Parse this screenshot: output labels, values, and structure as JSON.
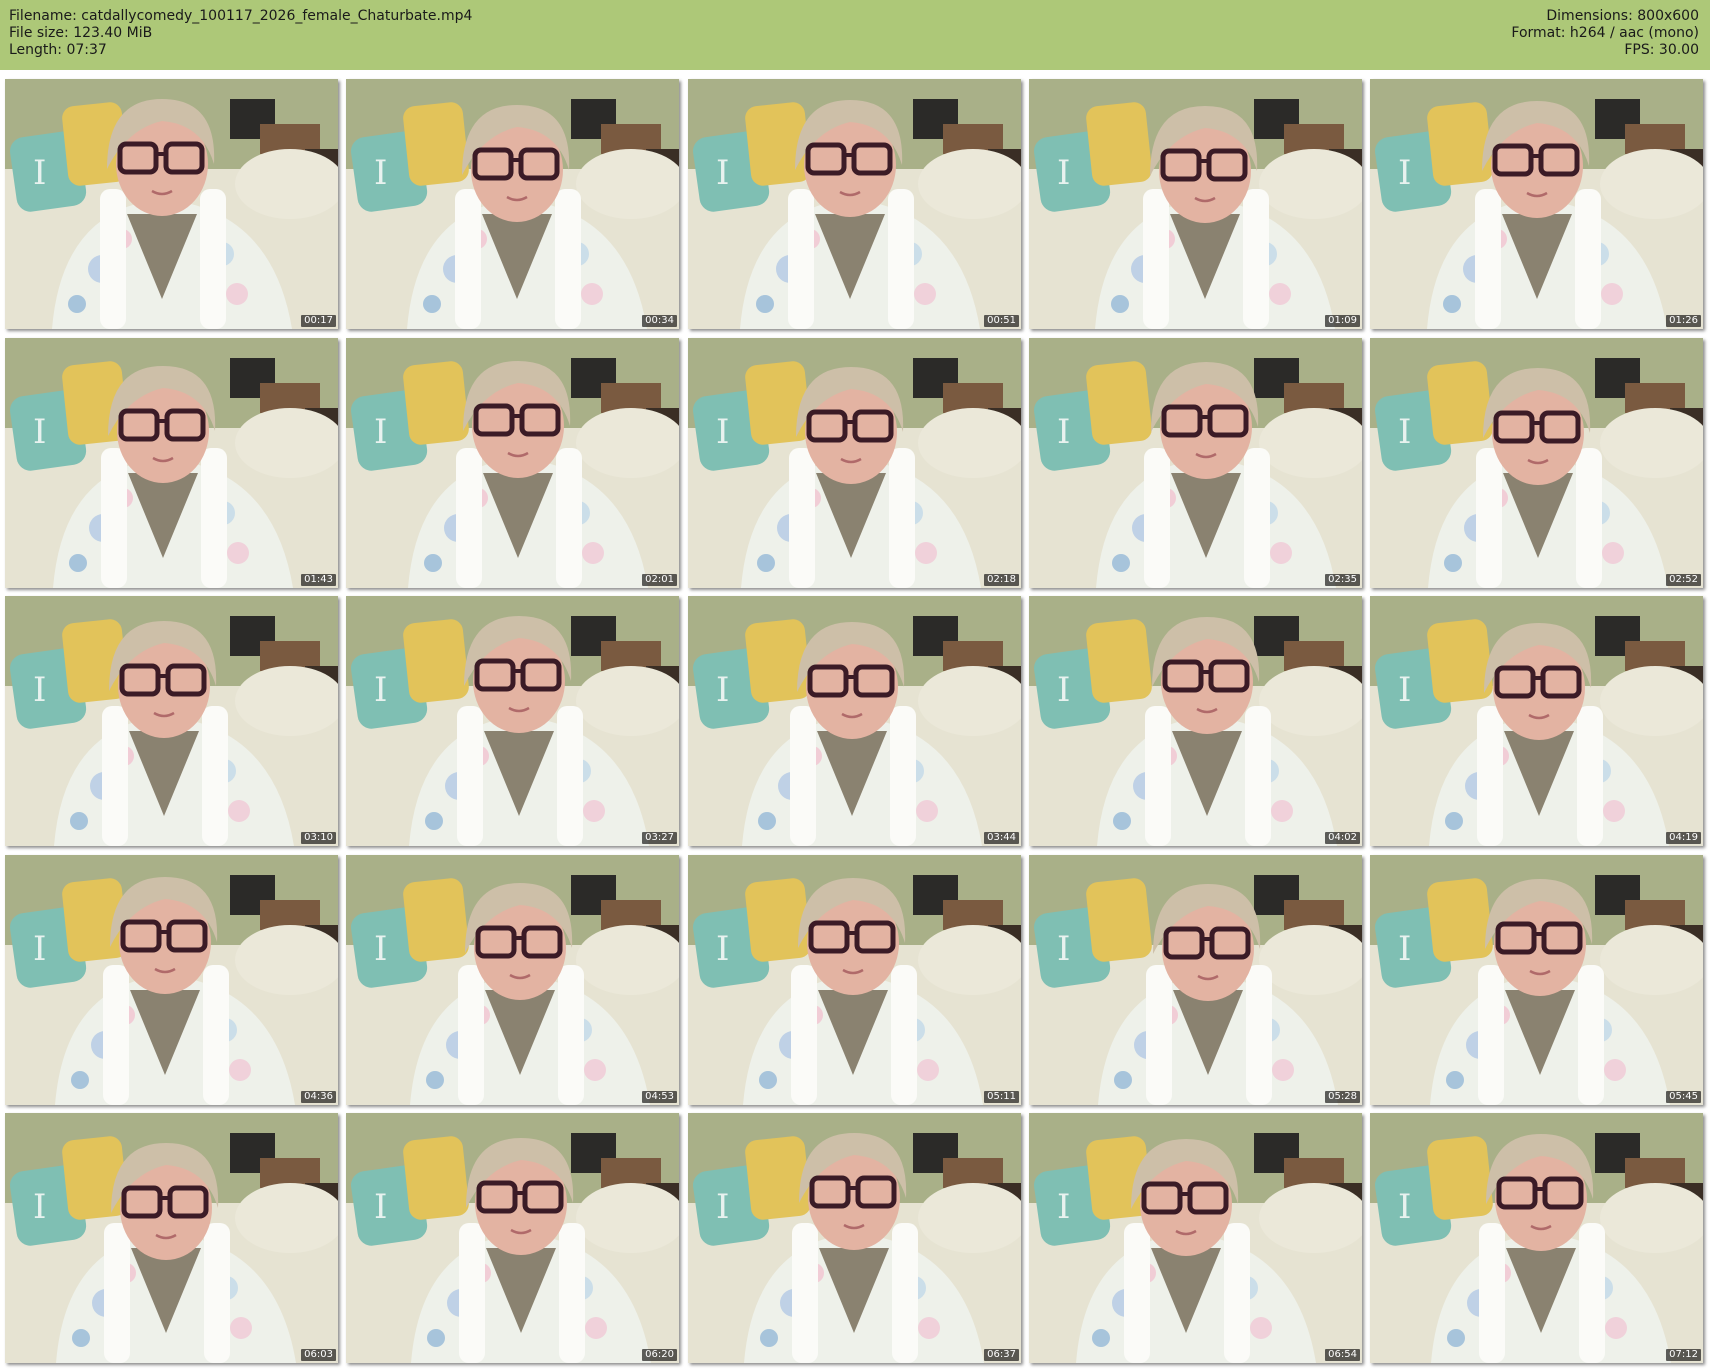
{
  "header": {
    "filename": "Filename: catdallycomedy_100117_2026_female_Chaturbate.mp4",
    "filesize": "File size: 123.40 MiB",
    "length": "Length: 07:37",
    "dimensions": "Dimensions: 800x600",
    "format": "Format: h264 / aac (mono)",
    "fps": "FPS: 30.00"
  },
  "thumbnails": [
    {
      "timestamp": "00:17"
    },
    {
      "timestamp": "00:34"
    },
    {
      "timestamp": "00:51"
    },
    {
      "timestamp": "01:09"
    },
    {
      "timestamp": "01:26"
    },
    {
      "timestamp": "01:43"
    },
    {
      "timestamp": "02:01"
    },
    {
      "timestamp": "02:18"
    },
    {
      "timestamp": "02:35"
    },
    {
      "timestamp": "02:52"
    },
    {
      "timestamp": "03:10"
    },
    {
      "timestamp": "03:27"
    },
    {
      "timestamp": "03:44"
    },
    {
      "timestamp": "04:02"
    },
    {
      "timestamp": "04:19"
    },
    {
      "timestamp": "04:36"
    },
    {
      "timestamp": "04:53"
    },
    {
      "timestamp": "05:11"
    },
    {
      "timestamp": "05:28"
    },
    {
      "timestamp": "05:45"
    },
    {
      "timestamp": "06:03"
    },
    {
      "timestamp": "06:20"
    },
    {
      "timestamp": "06:37"
    },
    {
      "timestamp": "06:54"
    },
    {
      "timestamp": "07:12"
    }
  ],
  "colors": {
    "header_bg": "#adc878",
    "wall": "#a9b088",
    "couch": "#e6e3d2",
    "pillow_teal": "#7fbfb3",
    "pillow_yellow": "#e2c35a",
    "robe": "#eef1ea",
    "skin": "#e3b3a2",
    "hair": "#cdbfa8",
    "glasses": "#3b1b26",
    "towel": "#fbfbf8",
    "mesh": "#8a8270"
  }
}
